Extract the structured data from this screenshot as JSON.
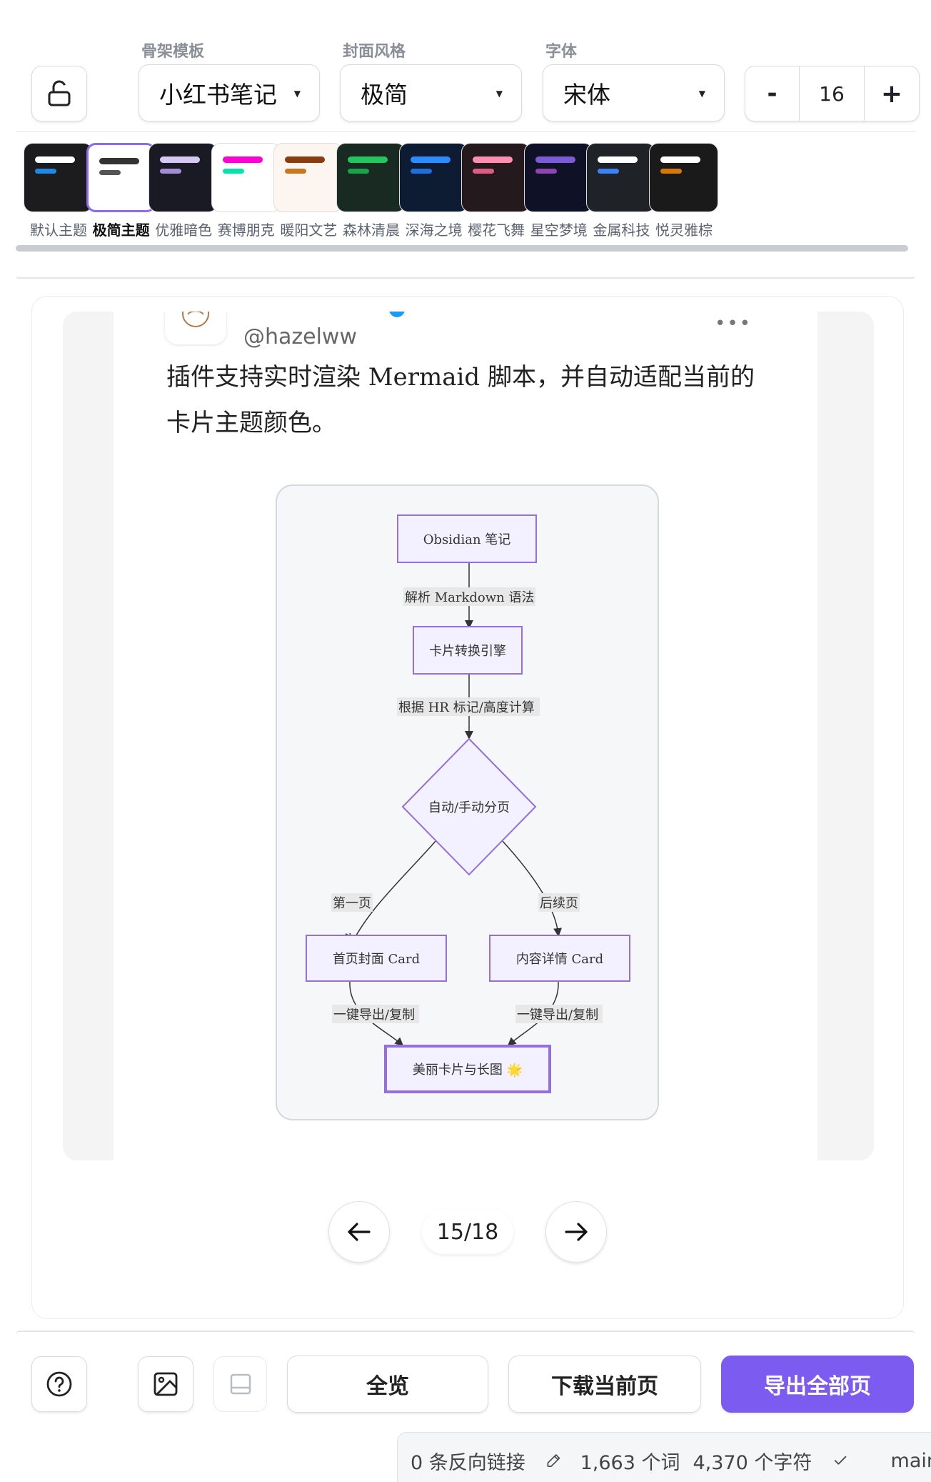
{
  "toolbar": {
    "lock_icon": "lock-open-icon",
    "skeleton_label": "骨架模板",
    "skeleton_value": "小红书笔记",
    "cover_label": "封面风格",
    "cover_value": "极简",
    "font_label": "字体",
    "font_value": "宋体",
    "font_size": "16",
    "minus": "-",
    "plus": "+"
  },
  "themes": [
    {
      "name": "默认主题",
      "bg": "#1c1c1e",
      "line1": "#ffffff",
      "line2": "#1e88e5"
    },
    {
      "name": "极简主题",
      "bg": "#ffffff",
      "line1": "#333333",
      "line2": "#555555",
      "active": true
    },
    {
      "name": "优雅暗色",
      "bg": "#1a1a24",
      "line1": "#d6c8f5",
      "line2": "#a38bd6"
    },
    {
      "name": "赛博朋克",
      "bg": "#ffffff",
      "line1": "#ff00d4",
      "line2": "#00e5a8"
    },
    {
      "name": "暖阳文艺",
      "bg": "#fdf6f0",
      "line1": "#8b3d12",
      "line2": "#c9761f"
    },
    {
      "name": "森林清晨",
      "bg": "#182a22",
      "line1": "#22c55e",
      "line2": "#16a34a"
    },
    {
      "name": "深海之境",
      "bg": "#0d1b33",
      "line1": "#2b8cff",
      "line2": "#1e6fd9"
    },
    {
      "name": "樱花飞舞",
      "bg": "#241a1e",
      "line1": "#ff8fb0",
      "line2": "#e05a86"
    },
    {
      "name": "星空梦境",
      "bg": "#0f1226",
      "line1": "#7c5cd6",
      "line2": "#8e44ad"
    },
    {
      "name": "金属科技",
      "bg": "#1f2328",
      "line1": "#ffffff",
      "line2": "#3b82f6"
    },
    {
      "name": "悦灵雅棕",
      "bg": "#1a1a1a",
      "line1": "#ffffff",
      "line2": "#d97706"
    }
  ],
  "card": {
    "handle": "@hazelww",
    "more_icon": "more-horizontal-icon",
    "body": "插件支持实时渲染 Mermaid 脚本，并自动适配当前的卡片主题颜色。",
    "diagram": {
      "nodes": {
        "n1": "Obsidian 笔记",
        "n2": "卡片转换引擎",
        "n3": "自动/手动分页",
        "n4": "首页封面 Card",
        "n5": "内容详情 Card",
        "n6": "美丽卡片与长图 🌟"
      },
      "edges": {
        "e1": "解析 Markdown 语法",
        "e2": "根据 HR 标记/高度计算",
        "e3": "第一页",
        "e4": "后续页",
        "e5": "一键导出/复制",
        "e6": "一键导出/复制"
      }
    }
  },
  "pagination": {
    "current": "15/18",
    "prev_icon": "arrow-left-icon",
    "next_icon": "arrow-right-icon"
  },
  "bottom": {
    "help_icon": "help-circle-icon",
    "image_icon": "image-icon",
    "layout_icon": "panel-bottom-icon",
    "overview": "全览",
    "download": "下载当前页",
    "export_all": "导出全部页",
    "accent": "#7c5cf0"
  },
  "status": {
    "backlinks": "0 条反向链接",
    "edit_icon": "pencil-icon",
    "words": "1,663 个词",
    "chars": "4,370 个字符",
    "check_icon": "check-icon",
    "branch": "main"
  }
}
